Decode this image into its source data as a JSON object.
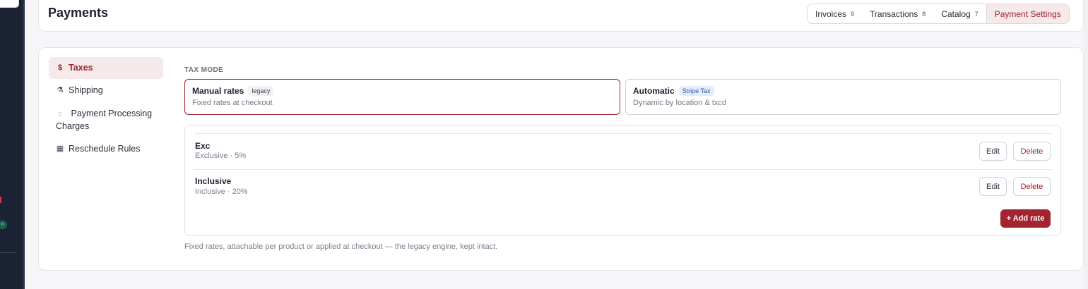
{
  "header": {
    "title": "Payments",
    "tabs": [
      {
        "label": "Invoices",
        "count": "9"
      },
      {
        "label": "Transactions",
        "count": "8"
      },
      {
        "label": "Catalog",
        "count": "7"
      },
      {
        "label": "Payment Settings",
        "count": ""
      }
    ],
    "active_tab": "Payment Settings"
  },
  "rail": {
    "pill_text": "w"
  },
  "sidebar": {
    "items": [
      {
        "icon": "$",
        "icon_name": "dollar-icon",
        "label": "Taxes"
      },
      {
        "icon": "⚗",
        "icon_name": "shipping-icon",
        "label": "Shipping"
      },
      {
        "icon": "◌",
        "icon_name": "processing-icon",
        "label": "Payment Processing Charges"
      },
      {
        "icon": "▦",
        "icon_name": "calendar-icon",
        "label": "Reschedule Rules"
      }
    ],
    "active": "Taxes"
  },
  "tax_mode": {
    "label": "TAX MODE",
    "options": [
      {
        "title": "Manual rates",
        "badge": "legacy",
        "desc": "Fixed rates at checkout"
      },
      {
        "title": "Automatic",
        "badge": "Stripe Tax",
        "desc": "Dynamic by location & txcd"
      }
    ],
    "selected": "Manual rates"
  },
  "rates": [
    {
      "name": "Exc",
      "detail": "Exclusive · 5%"
    },
    {
      "name": "Inclusive",
      "detail": "Inclusive · 20%"
    }
  ],
  "buttons": {
    "edit": "Edit",
    "delete": "Delete",
    "add_rate": "+ Add rate"
  },
  "footnote": "Fixed rates, attachable per product or applied at checkout — the legacy engine, kept intact.",
  "colors": {
    "accent": "#a3232f",
    "accent_bg": "#f5e9ea",
    "rail": "#1b2233",
    "stripe_badge": "#2859a8"
  }
}
